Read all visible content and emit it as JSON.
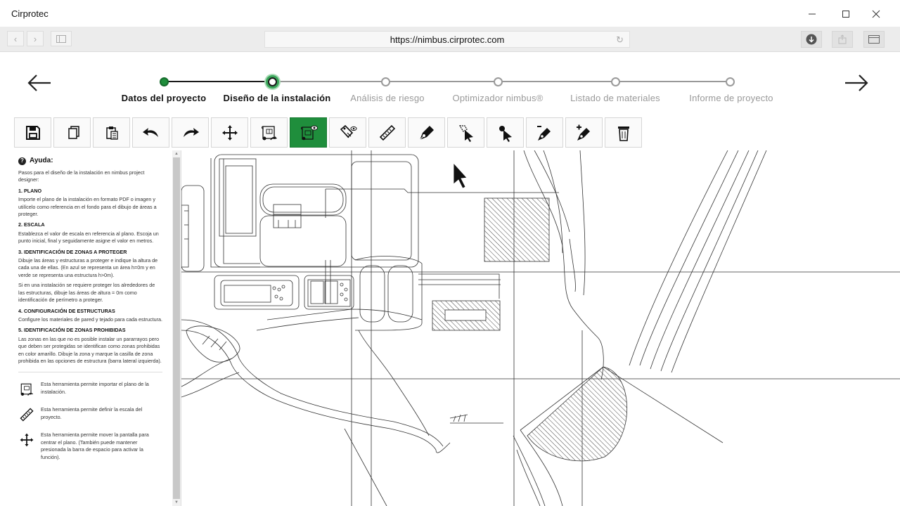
{
  "app": {
    "title": "Cirprotec",
    "minimize_icon": "minimize-icon",
    "maximize_icon": "maximize-icon",
    "close_icon": "close-icon"
  },
  "browser": {
    "url": "https://nimbus.cirprotec.com"
  },
  "stepper": {
    "steps": [
      {
        "label": "Datos del proyecto",
        "state": "done"
      },
      {
        "label": "Diseño de la instalación",
        "state": "current"
      },
      {
        "label": "Análisis de riesgo",
        "state": "pending"
      },
      {
        "label": "Optimizador nimbus®",
        "state": "pending"
      },
      {
        "label": "Listado de materiales",
        "state": "pending"
      },
      {
        "label": "Informe de proyecto",
        "state": "pending"
      }
    ]
  },
  "toolbar": {
    "tools": [
      {
        "name": "save-icon"
      },
      {
        "name": "copy-icon"
      },
      {
        "name": "paste-icon"
      },
      {
        "name": "undo-icon"
      },
      {
        "name": "redo-icon"
      },
      {
        "name": "move-icon"
      },
      {
        "name": "import-plan-icon"
      },
      {
        "name": "view-plan-icon",
        "active": true
      },
      {
        "name": "tag-view-icon"
      },
      {
        "name": "ruler-icon"
      },
      {
        "name": "pen-icon"
      },
      {
        "name": "select-node-icon"
      },
      {
        "name": "select-point-icon"
      },
      {
        "name": "pen-minus-icon"
      },
      {
        "name": "pen-plus-icon"
      },
      {
        "name": "trash-icon"
      }
    ],
    "active_color": "#1f8e3c"
  },
  "help": {
    "title": "Ayuda:",
    "intro": "Pasos para el diseño de la instalación en nimbus project designer:",
    "sections": [
      {
        "title": "1. PLANO",
        "paragraphs": [
          "Importe el plano de la instalación en formato PDF o imagen y utilícelo como referencia en el fondo para el dibujo de áreas a proteger."
        ]
      },
      {
        "title": "2. ESCALA",
        "paragraphs": [
          "Establezca el valor de escala en referencia al plano. Escoja un punto inicial, final y seguidamente asigne el valor en metros."
        ]
      },
      {
        "title": "3. IDENTIFICACIÓN DE ZONAS A PROTEGER",
        "paragraphs": [
          "Dibuje las áreas y estructuras a proteger e indique la altura de cada una de ellas. (En azul se representa un área h=0m y en verde se representa una estructura h>0m).",
          "Si en una instalación se requiere proteger los alrededores de las estructuras, dibuje las áreas de altura = 0m como identificación de perímetro a proteger."
        ]
      },
      {
        "title": "4. CONFIGURACIÓN DE ESTRUCTURAS",
        "paragraphs": [
          "Configure los materiales de pared y tejado para cada estructura."
        ]
      },
      {
        "title": "5. IDENTIFICACIÓN DE ZONAS PROHIBIDAS",
        "paragraphs": [
          "Las zonas en las que no es posible instalar un pararrayos pero que deben ser protegidas se identifican como zonas prohibidas en color amarillo. Dibuje la zona y marque la casilla de zona prohibida en las opciones de estructura (barra lateral izquierda)."
        ]
      }
    ],
    "tool_help": [
      {
        "icon": "import-plan-icon",
        "text": "Esta herramienta permite importar el plano de la instalación."
      },
      {
        "icon": "ruler-icon",
        "text": "Esta herramienta permite definir la escala del proyecto."
      },
      {
        "icon": "move-icon",
        "text": "Esta herramienta permite mover la pantalla para centrar el plano. (También puede mantener presionada la barra de espacio para activar la función)."
      }
    ]
  }
}
